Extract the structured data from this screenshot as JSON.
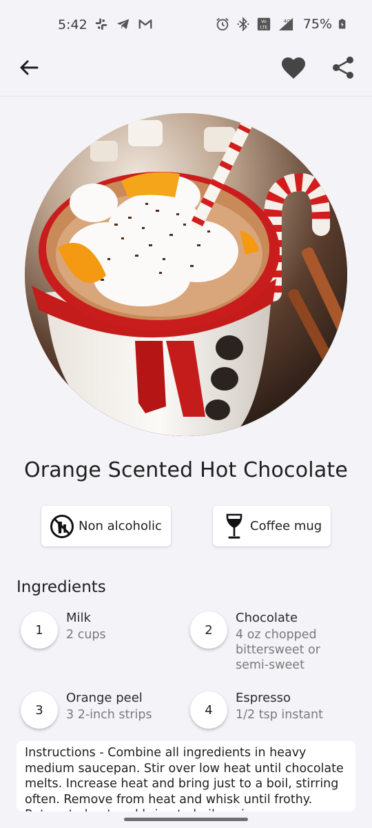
{
  "status_bar": {
    "time": "5:42",
    "battery": "75%",
    "notification_icons": [
      "slack-icon",
      "telegram-icon",
      "gmail-icon"
    ],
    "system_icons": [
      "alarm-icon",
      "bluetooth-icon",
      "volte-icon",
      "signal-4g-icon",
      "battery-charging-icon"
    ],
    "network_label": "4G",
    "volte_label": "Vo LTE"
  },
  "app_bar": {
    "icons": [
      "back-arrow-icon",
      "heart-icon",
      "share-icon"
    ]
  },
  "recipe": {
    "title": "Orange Scented Hot Chocolate",
    "alcoholic_label": "Non alcoholic",
    "glass_label": "Coffee mug",
    "ingredients_heading": "Ingredients",
    "ingredients": [
      {
        "number": "1",
        "name": "Milk",
        "quantity": "2 cups"
      },
      {
        "number": "2",
        "name": "Chocolate",
        "quantity": "4 oz chopped bittersweet or semi-sweet"
      },
      {
        "number": "3",
        "name": "Orange peel",
        "quantity": "3 2-inch strips"
      },
      {
        "number": "4",
        "name": "Espresso",
        "quantity": "1/2 tsp instant"
      }
    ],
    "instructions": "Instructions - Combine all ingredients in heavy medium saucepan. Stir over low heat until chocolate melts. Increase heat and bring just to a boil, stirring often. Remove from heat and whisk until frothy. Return to heat and bring to boil again"
  },
  "colors": {
    "background": "#f4f3f7",
    "mug_red": "#c81a1a",
    "cream": "#f7f4ee",
    "orange": "#f39a12",
    "cocoa": "#4a2a1a"
  }
}
